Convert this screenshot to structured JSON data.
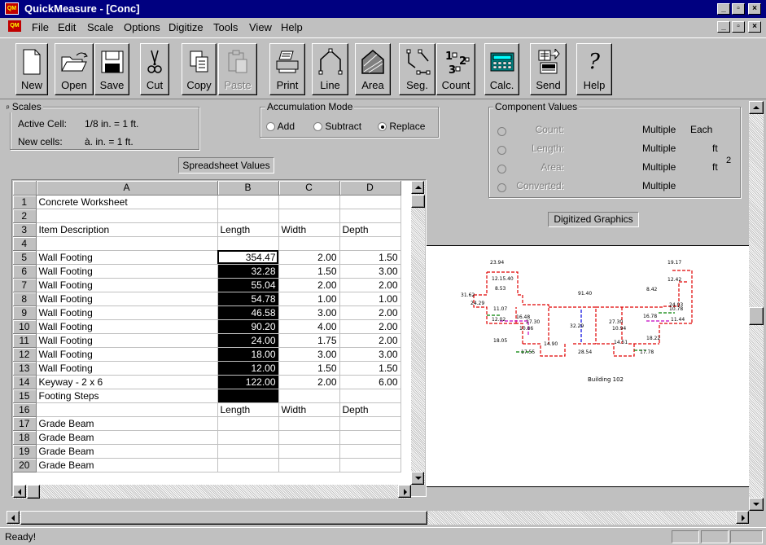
{
  "window": {
    "title": "QuickMeasure - [Conc]",
    "app_icon_text": "QM"
  },
  "menu": [
    "File",
    "Edit",
    "Scale",
    "Options",
    "Digitize",
    "Tools",
    "View",
    "Help"
  ],
  "toolbar": [
    {
      "id": "new",
      "label": "New",
      "icon": "new-document-icon",
      "enabled": true
    },
    {
      "id": "open",
      "label": "Open",
      "icon": "open-folder-icon",
      "enabled": true
    },
    {
      "id": "save",
      "label": "Save",
      "icon": "save-disk-icon",
      "enabled": true
    },
    {
      "id": "cut",
      "label": "Cut",
      "icon": "scissors-icon",
      "enabled": true
    },
    {
      "id": "copy",
      "label": "Copy",
      "icon": "copy-icon",
      "enabled": true
    },
    {
      "id": "paste",
      "label": "Paste",
      "icon": "paste-icon",
      "enabled": false
    },
    {
      "id": "print",
      "label": "Print",
      "icon": "printer-icon",
      "enabled": true
    },
    {
      "id": "line",
      "label": "Line",
      "icon": "line-measure-icon",
      "enabled": true
    },
    {
      "id": "area",
      "label": "Area",
      "icon": "area-measure-icon",
      "enabled": true
    },
    {
      "id": "seg",
      "label": "Seg.",
      "icon": "segment-measure-icon",
      "enabled": true
    },
    {
      "id": "count",
      "label": "Count",
      "icon": "count-icon",
      "enabled": true
    },
    {
      "id": "calc",
      "label": "Calc.",
      "icon": "calculator-icon",
      "enabled": true
    },
    {
      "id": "send",
      "label": "Send",
      "icon": "send-icon",
      "enabled": true
    },
    {
      "id": "help",
      "label": "Help",
      "icon": "help-question-icon",
      "enabled": true
    }
  ],
  "scales": {
    "title": "Scales",
    "active_label": "Active Cell:",
    "active_value": "1/8 in. = 1 ft.",
    "new_label": "New cells:",
    "new_value": "à. in. = 1 ft."
  },
  "accumulation": {
    "title": "Accumulation Mode",
    "options": [
      "Add",
      "Subtract",
      "Replace"
    ],
    "selected": "Replace"
  },
  "spreadsheet_button": "Spreadsheet Values",
  "component": {
    "title": "Component Values",
    "rows": [
      {
        "label": "Count:",
        "value": "Multiple",
        "unit": "Each",
        "sup": ""
      },
      {
        "label": "Length:",
        "value": "Multiple",
        "unit": "ft",
        "sup": ""
      },
      {
        "label": "Area:",
        "value": "Multiple",
        "unit": "ft",
        "sup": "2"
      },
      {
        "label": "Converted:",
        "value": "Multiple",
        "unit": "",
        "sup": ""
      }
    ]
  },
  "digitized_button": "Digitized Graphics",
  "sheet": {
    "columns": [
      "A",
      "B",
      "C",
      "D"
    ],
    "rows": [
      {
        "n": "1",
        "a": "Concrete Worksheet",
        "b": "",
        "c": "",
        "d": ""
      },
      {
        "n": "2",
        "a": "",
        "b": "",
        "c": "",
        "d": ""
      },
      {
        "n": "3",
        "a": "Item Description",
        "b": "Length",
        "c": "Width",
        "d": "Depth"
      },
      {
        "n": "4",
        "a": "",
        "b": "",
        "c": "",
        "d": ""
      },
      {
        "n": "5",
        "a": "Wall Footing",
        "b": "354.47",
        "c": "2.00",
        "d": "1.50"
      },
      {
        "n": "6",
        "a": "Wall Footing",
        "b": "32.28",
        "c": "1.50",
        "d": "3.00"
      },
      {
        "n": "7",
        "a": "Wall Footing",
        "b": "55.04",
        "c": "2.00",
        "d": "2.00"
      },
      {
        "n": "8",
        "a": "Wall Footing",
        "b": "54.78",
        "c": "1.00",
        "d": "1.00"
      },
      {
        "n": "9",
        "a": "Wall Footing",
        "b": "46.58",
        "c": "3.00",
        "d": "2.00"
      },
      {
        "n": "10",
        "a": "Wall Footing",
        "b": "90.20",
        "c": "4.00",
        "d": "2.00"
      },
      {
        "n": "11",
        "a": "Wall Footing",
        "b": "24.00",
        "c": "1.75",
        "d": "2.00"
      },
      {
        "n": "12",
        "a": "Wall Footing",
        "b": "18.00",
        "c": "3.00",
        "d": "3.00"
      },
      {
        "n": "13",
        "a": "Wall Footing",
        "b": "12.00",
        "c": "1.50",
        "d": "1.50"
      },
      {
        "n": "14",
        "a": "Keyway - 2 x 6",
        "b": "122.00",
        "c": "2.00",
        "d": "6.00"
      },
      {
        "n": "15",
        "a": "Footing Steps",
        "b": "",
        "c": "",
        "d": ""
      },
      {
        "n": "16",
        "a": "",
        "b": "Length",
        "c": "Width",
        "d": "Depth"
      },
      {
        "n": "17",
        "a": "Grade Beam",
        "b": "",
        "c": "",
        "d": ""
      },
      {
        "n": "18",
        "a": "Grade Beam",
        "b": "",
        "c": "",
        "d": ""
      },
      {
        "n": "19",
        "a": "Grade Beam",
        "b": "",
        "c": "",
        "d": ""
      },
      {
        "n": "20",
        "a": "Grade Beam",
        "b": "",
        "c": "",
        "d": ""
      }
    ]
  },
  "drawing": {
    "labels": [
      "23.94",
      "12.15.40",
      "8.53",
      "31.62",
      "24.29",
      "11.07",
      "12.02",
      "16.48",
      "27.30",
      "10.86",
      "18.05",
      "17.55",
      "14.90",
      "91.40",
      "32.29",
      "28.54",
      "27.30",
      "10.94",
      "14.51",
      "17.78",
      "18.22",
      "16.78",
      "19.17",
      "12.42",
      "8.42",
      "24.03",
      "10.78",
      "11.44"
    ],
    "building_label": "Building 102",
    "colors": {
      "red": "#e00000",
      "blue": "#0000e0",
      "green": "#008000",
      "magenta": "#c000c0"
    }
  },
  "status": {
    "text": "Ready!"
  }
}
